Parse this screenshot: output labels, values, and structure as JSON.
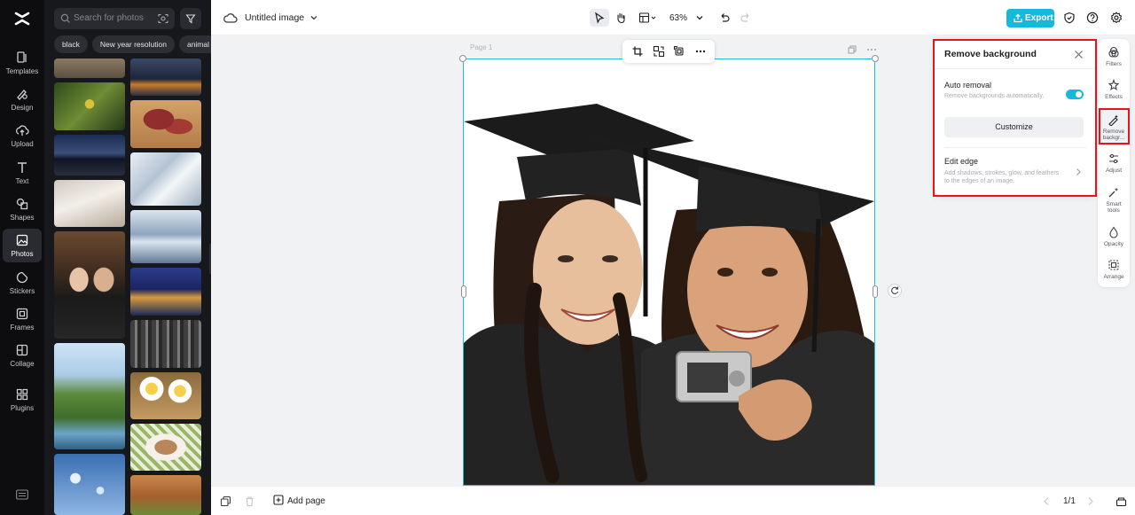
{
  "rail": {
    "items": [
      {
        "label": "Templates",
        "icon": "templates-icon"
      },
      {
        "label": "Design",
        "icon": "design-icon"
      },
      {
        "label": "Upload",
        "icon": "upload-icon"
      },
      {
        "label": "Text",
        "icon": "text-icon"
      },
      {
        "label": "Shapes",
        "icon": "shapes-icon"
      },
      {
        "label": "Photos",
        "icon": "photos-icon",
        "active": true
      },
      {
        "label": "Stickers",
        "icon": "stickers-icon"
      },
      {
        "label": "Frames",
        "icon": "frames-icon"
      },
      {
        "label": "Collage",
        "icon": "collage-icon"
      },
      {
        "label": "Plugins",
        "icon": "plugins-icon"
      }
    ]
  },
  "photos_panel": {
    "search_placeholder": "Search for photos",
    "chips": [
      "black",
      "New year resolution",
      "animal"
    ]
  },
  "topbar": {
    "doc_title": "Untitled image",
    "zoom": "63%",
    "export_label": "Export"
  },
  "canvas": {
    "page_label": "Page 1"
  },
  "bottombar": {
    "add_page_label": "Add page",
    "page_count": "1/1"
  },
  "right_tools": {
    "items": [
      {
        "label": "Filters",
        "icon": "filters-icon"
      },
      {
        "label": "Effects",
        "icon": "effects-icon"
      },
      {
        "label": "Remove backgr...",
        "icon": "remove-background-icon",
        "active": true
      },
      {
        "label": "Adjust",
        "icon": "adjust-icon"
      },
      {
        "label": "Smart tools",
        "icon": "smart-tools-icon"
      },
      {
        "label": "Opacity",
        "icon": "opacity-icon"
      },
      {
        "label": "Arrange",
        "icon": "arrange-icon"
      }
    ]
  },
  "remove_bg": {
    "title": "Remove background",
    "auto_removal_label": "Auto removal",
    "auto_removal_desc": "Remove backgrounds automatically.",
    "auto_removal_on": true,
    "customize_label": "Customize",
    "edit_edge_label": "Edit edge",
    "edit_edge_desc": "Add shadows, strokes, glow, and feathers to the edges of an image."
  },
  "colors": {
    "accent": "#16b8dc",
    "highlight": "#e8141c",
    "rail_bg": "#0d0d0f",
    "panel_bg": "#17181c"
  }
}
